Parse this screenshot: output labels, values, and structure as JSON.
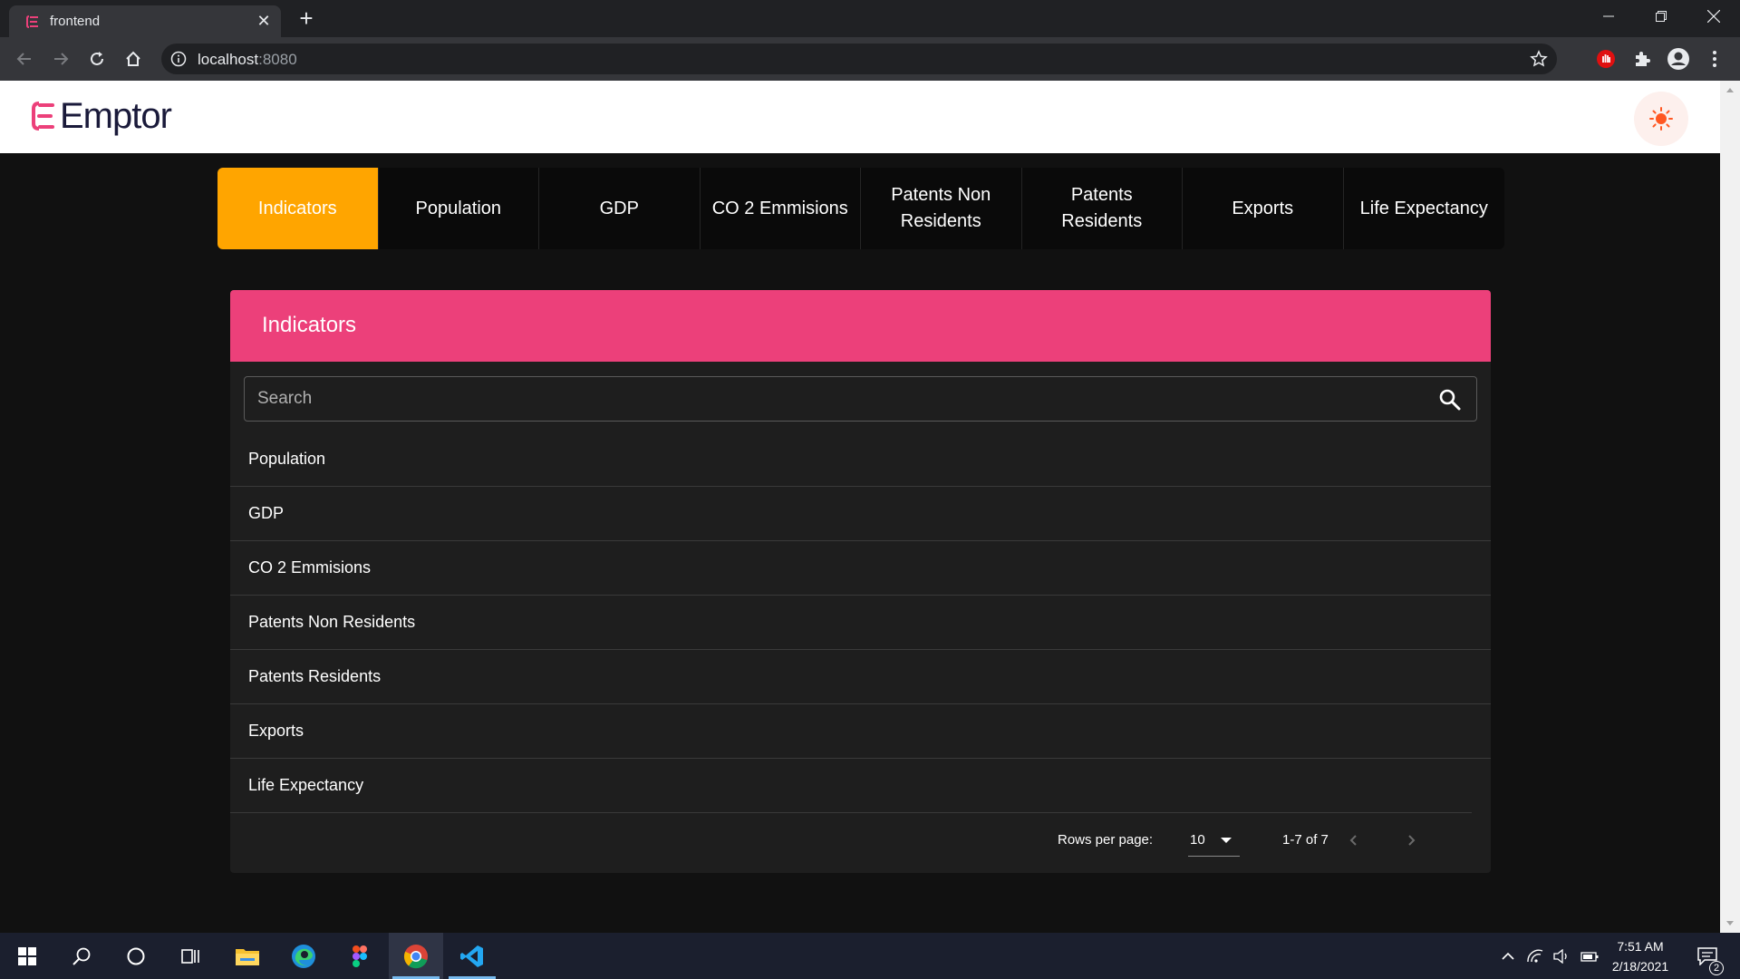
{
  "browser": {
    "tab_title": "frontend",
    "url_host": "localhost",
    "url_port": ":8080"
  },
  "app": {
    "logo_text": "Emptor",
    "brand_color": "#ec407a",
    "accent_color": "#ffa500"
  },
  "nav": {
    "tabs": [
      {
        "label": "Indicators"
      },
      {
        "label": "Population"
      },
      {
        "label": "GDP"
      },
      {
        "label": "CO 2 Emmisions"
      },
      {
        "label": "Patents Non Residents"
      },
      {
        "label": "Patents Residents"
      },
      {
        "label": "Exports"
      },
      {
        "label": "Life Expectancy"
      }
    ]
  },
  "card": {
    "title": "Indicators",
    "search_placeholder": "Search",
    "rows": [
      {
        "label": "Population"
      },
      {
        "label": "GDP"
      },
      {
        "label": "CO 2 Emmisions"
      },
      {
        "label": "Patents Non Residents"
      },
      {
        "label": "Patents Residents"
      },
      {
        "label": "Exports"
      },
      {
        "label": "Life Expectancy"
      }
    ],
    "pager": {
      "rows_per_page_label": "Rows per page:",
      "rows_per_page_value": "10",
      "range_text": "1-7 of 7"
    }
  },
  "taskbar": {
    "time": "7:51 AM",
    "date": "2/18/2021",
    "notification_count": "2"
  }
}
